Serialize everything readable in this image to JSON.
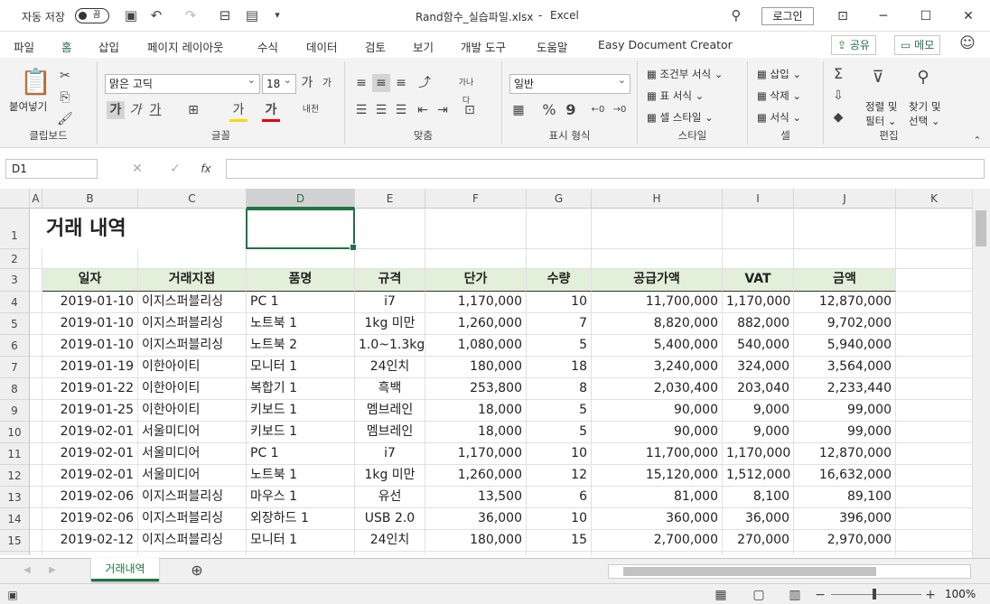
{
  "titlebar": {
    "autosave": "자동 저장",
    "toggle": "끔",
    "filename": "Rand함수_실습파일.xlsx",
    "sep": "-",
    "app": "Excel",
    "login": "로그인"
  },
  "menu": {
    "items": [
      "파일",
      "홈",
      "삽입",
      "페이지 레이아웃",
      "수식",
      "데이터",
      "검토",
      "보기",
      "개발 도구",
      "도움말",
      "Easy Document Creator"
    ],
    "share": "공유",
    "memo": "메모"
  },
  "ribbon": {
    "clipboard": {
      "paste": "붙여넣기",
      "label": "클립보드"
    },
    "font": {
      "name": "맑은 고딕",
      "size": "18",
      "bold": "가",
      "italic": "가",
      "underline": "가",
      "label": "글꼴",
      "grow": "가",
      "shrink": "가",
      "fill": "가",
      "color": "가"
    },
    "align": {
      "label": "맞춤",
      "wrap": "가나다"
    },
    "number": {
      "format": "일반",
      "label": "표시 형식",
      "percent": "%",
      "comma": "9"
    },
    "styles": {
      "cond": "조건부 서식",
      "table": "표 서식",
      "cell": "셀 스타일",
      "label": "스타일"
    },
    "cells": {
      "insert": "삽입",
      "delete": "삭제",
      "format": "서식",
      "label": "셀"
    },
    "edit": {
      "sort": "정렬 및",
      "sort2": "필터",
      "find": "찾기 및",
      "find2": "선택",
      "label": "편집"
    }
  },
  "formula": {
    "namebox": "D1",
    "fx": "fx"
  },
  "columns": [
    "A",
    "B",
    "C",
    "D",
    "E",
    "F",
    "G",
    "H",
    "I",
    "J",
    "K"
  ],
  "sheet": {
    "title": "거래 내역",
    "headers": [
      "일자",
      "거래지점",
      "품명",
      "규격",
      "단가",
      "수량",
      "공급가액",
      "VAT",
      "금액"
    ],
    "rows": [
      [
        "2019-01-10",
        "이지스퍼블리싱",
        "PC 1",
        "i7",
        "1,170,000",
        "10",
        "11,700,000",
        "1,170,000",
        "12,870,000"
      ],
      [
        "2019-01-10",
        "이지스퍼블리싱",
        "노트북 1",
        "1kg 미만",
        "1,260,000",
        "7",
        "8,820,000",
        "882,000",
        "9,702,000"
      ],
      [
        "2019-01-10",
        "이지스퍼블리싱",
        "노트북 2",
        "1.0~1.3kg",
        "1,080,000",
        "5",
        "5,400,000",
        "540,000",
        "5,940,000"
      ],
      [
        "2019-01-19",
        "이한아이티",
        "모니터 1",
        "24인치",
        "180,000",
        "18",
        "3,240,000",
        "324,000",
        "3,564,000"
      ],
      [
        "2019-01-22",
        "이한아이티",
        "복합기 1",
        "흑백",
        "253,800",
        "8",
        "2,030,400",
        "203,040",
        "2,233,440"
      ],
      [
        "2019-01-25",
        "이한아이티",
        "키보드 1",
        "멤브레인",
        "18,000",
        "5",
        "90,000",
        "9,000",
        "99,000"
      ],
      [
        "2019-02-01",
        "서울미디어",
        "키보드 1",
        "멤브레인",
        "18,000",
        "5",
        "90,000",
        "9,000",
        "99,000"
      ],
      [
        "2019-02-01",
        "서울미디어",
        "PC 1",
        "i7",
        "1,170,000",
        "10",
        "11,700,000",
        "1,170,000",
        "12,870,000"
      ],
      [
        "2019-02-01",
        "서울미디어",
        "노트북 1",
        "1kg 미만",
        "1,260,000",
        "12",
        "15,120,000",
        "1,512,000",
        "16,632,000"
      ],
      [
        "2019-02-06",
        "이지스퍼블리싱",
        "마우스 1",
        "유선",
        "13,500",
        "6",
        "81,000",
        "8,100",
        "89,100"
      ],
      [
        "2019-02-06",
        "이지스퍼블리싱",
        "외장하드 1",
        "USB 2.0",
        "36,000",
        "10",
        "360,000",
        "36,000",
        "396,000"
      ],
      [
        "2019-02-12",
        "이지스퍼블리싱",
        "모니터 1",
        "24인치",
        "180,000",
        "15",
        "2,700,000",
        "270,000",
        "2,970,000"
      ]
    ]
  },
  "tabs": {
    "sheet": "거래내역"
  },
  "status": {
    "zoom": "100%"
  }
}
